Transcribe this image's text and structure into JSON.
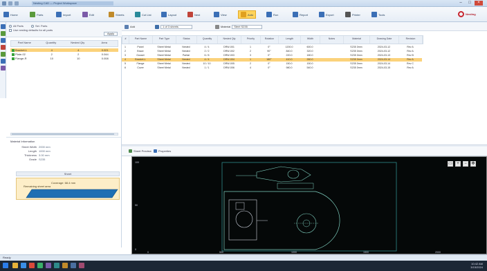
{
  "window": {
    "title": "Nesting CAD — Project Workspace"
  },
  "ribbon": {
    "items": [
      {
        "label": "Home",
        "icon": "home-icon",
        "color": "#3b6fb6"
      },
      {
        "label": "Parts",
        "icon": "parts-icon",
        "color": "#5a9a3c"
      },
      {
        "label": "Import",
        "icon": "import-icon",
        "color": "#3b6fb6"
      },
      {
        "label": "Edit",
        "icon": "edit-icon",
        "color": "#7b5aa8"
      },
      {
        "label": "Sheets",
        "icon": "sheet-icon",
        "color": "#c08a2a"
      },
      {
        "label": "Cut List",
        "icon": "list-icon",
        "color": "#2a8a9a"
      },
      {
        "label": "Layout",
        "icon": "layout-icon",
        "color": "#3b6fb6"
      },
      {
        "label": "Nest",
        "icon": "nest-icon",
        "color": "#c0443a"
      },
      {
        "label": "View",
        "icon": "view-icon",
        "color": "#3b6fb6"
      },
      {
        "label": "Auto",
        "icon": "auto-nest-icon",
        "color": "#e0a020",
        "active": true
      },
      {
        "label": "Run",
        "icon": "run-icon",
        "color": "#3b6fb6"
      },
      {
        "label": "Report",
        "icon": "report-icon",
        "color": "#3b6fb6"
      },
      {
        "label": "Export",
        "icon": "export-icon",
        "color": "#3b6fb6"
      },
      {
        "label": "Printer",
        "icon": "printer-icon",
        "color": "#555555"
      },
      {
        "label": "Tools",
        "icon": "tools-icon",
        "color": "#3b6fb6"
      }
    ],
    "logo": "Nesting"
  },
  "left_panel": {
    "options": {
      "radio1": "All Parts",
      "radio2": "Sel. Parts",
      "check1": "Use nesting defaults for all parts"
    },
    "button": "Apply",
    "headers": [
      "Part Name",
      "Quantity",
      "Nested Qty",
      "Area"
    ],
    "rows": [
      {
        "name": "Bracket-L",
        "qty": "4",
        "nested": "4",
        "area": "0.021",
        "selected": true
      },
      {
        "name": "Plate-02",
        "qty": "2",
        "nested": "2",
        "area": "0.044",
        "selected": false
      },
      {
        "name": "Flange-R",
        "qty": "10",
        "nested": "10",
        "area": "0.008",
        "selected": false
      }
    ]
  },
  "material": {
    "title": "Material Information",
    "fields": [
      {
        "k": "Sheet Width",
        "v": "2000 mm"
      },
      {
        "k": "Length",
        "v": "1000 mm"
      },
      {
        "k": "Thickness",
        "v": "3.00 mm"
      },
      {
        "k": "Grade",
        "v": "S235"
      }
    ]
  },
  "sheet_preview": {
    "bar": "Sheet",
    "lines": [
      "Coverage: 68.4 mm",
      "Remaining sheet area"
    ]
  },
  "table_toolbar": {
    "add": "Add",
    "sheet_label": "Sheet",
    "sheet_value": "1 of 3 sheets",
    "filter_label": "Material",
    "filter_value": "Steel S235"
  },
  "grid": {
    "headers": [
      "#",
      "Part Name",
      "Part Type",
      "Status",
      "Quantity",
      "Nested Qty",
      "Priority",
      "Rotation",
      "Length",
      "Width",
      "Notes",
      "Material",
      "Drawing Date",
      "Revision"
    ],
    "rows": [
      {
        "c": [
          "1",
          "Panel",
          "Sheet Metal",
          "Nested",
          "4 / 4",
          "DRW-001",
          "1",
          "0°",
          "1200.0",
          "600.0",
          "",
          "S235 3mm",
          "2024-03-12",
          "Rev A"
        ],
        "selected": false
      },
      {
        "c": [
          "2",
          "Brace",
          "Sheet Metal",
          "Nested",
          "2 / 2",
          "DRW-002",
          "2",
          "90°",
          "840.0",
          "320.0",
          "",
          "S235 3mm",
          "2024-03-12",
          "Rev A"
        ],
        "selected": false
      },
      {
        "c": [
          "3",
          "Gusset",
          "Sheet Metal",
          "Partial",
          "6 / 8",
          "DRW-003",
          "3",
          "0°",
          "220.0",
          "180.0",
          "",
          "S235 3mm",
          "2024-03-13",
          "Rev B"
        ],
        "selected": false
      },
      {
        "c": [
          "4",
          "Bracket-L",
          "Sheet Metal",
          "Nested",
          "4 / 4",
          "DRW-004",
          "1",
          "180°",
          "410.0",
          "260.0",
          "",
          "S235 3mm",
          "2024-03-14",
          "Rev A"
        ],
        "selected": true
      },
      {
        "c": [
          "5",
          "Flange",
          "Sheet Metal",
          "Nested",
          "10 / 10",
          "DRW-005",
          "2",
          "0°",
          "150.0",
          "150.0",
          "",
          "S235 3mm",
          "2024-03-14",
          "Rev C"
        ],
        "selected": false
      },
      {
        "c": [
          "6",
          "Cover",
          "Sheet Metal",
          "Nested",
          "1 / 1",
          "DRW-006",
          "4",
          "0°",
          "980.0",
          "540.0",
          "",
          "S235 3mm",
          "2024-03-15",
          "Rev A"
        ],
        "selected": false
      }
    ]
  },
  "view": {
    "tab1": "Sheet Preview",
    "tab2": "Properties",
    "axis": {
      "y_top": "100",
      "y_mid": "50",
      "y_bot": "0",
      "x1": "0",
      "x2": "500",
      "x3": "1000",
      "x4": "1500",
      "x5": "2000"
    }
  },
  "status": "Ready",
  "taskbar": {
    "time": "10:42 AM",
    "date": "3/15/2024"
  }
}
